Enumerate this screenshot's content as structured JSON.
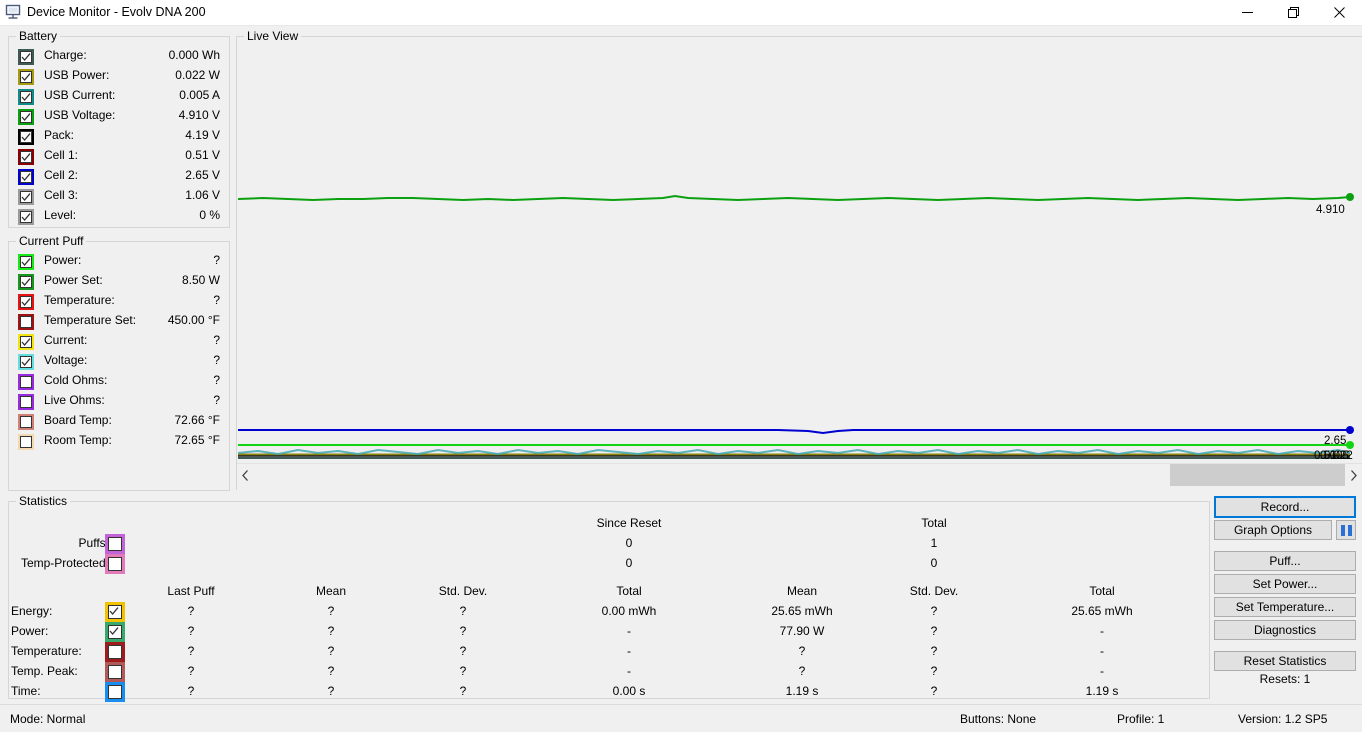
{
  "window": {
    "title": "Device Monitor - Evolv DNA 200",
    "icon": "monitor-icon",
    "controls": {
      "minimize": "minimize-icon",
      "maximize": "maximize-icon",
      "close": "close-icon"
    }
  },
  "battery": {
    "legend": "Battery",
    "items": [
      {
        "label": "Charge:",
        "value": "0.000 Wh",
        "checked": true,
        "color": "#3d5b54"
      },
      {
        "label": "USB Power:",
        "value": "0.022 W",
        "checked": true,
        "color": "#a89a10"
      },
      {
        "label": "USB Current:",
        "value": "0.005 A",
        "checked": true,
        "color": "#118a8a"
      },
      {
        "label": "USB Voltage:",
        "value": "4.910 V",
        "checked": true,
        "color": "#0aa010"
      },
      {
        "label": "Pack:",
        "value": "4.19 V",
        "checked": true,
        "color": "#000000"
      },
      {
        "label": "Cell 1:",
        "value": "0.51 V",
        "checked": true,
        "color": "#8a0000"
      },
      {
        "label": "Cell 2:",
        "value": "2.65 V",
        "checked": true,
        "color": "#0000d0"
      },
      {
        "label": "Cell 3:",
        "value": "1.06 V",
        "checked": true,
        "color": "#9a9a9a"
      },
      {
        "label": "Level:",
        "value": "0 %",
        "checked": true,
        "color": "#9a9a9a"
      }
    ]
  },
  "current_puff": {
    "legend": "Current Puff",
    "items": [
      {
        "label": "Power:",
        "value": "?",
        "checked": true,
        "color": "#18ea18"
      },
      {
        "label": "Power Set:",
        "value": "8.50 W",
        "checked": true,
        "color": "#18971f"
      },
      {
        "label": "Temperature:",
        "value": "?",
        "checked": true,
        "color": "#e81414"
      },
      {
        "label": "Temperature Set:",
        "value": "450.00 °F",
        "checked": false,
        "color": "#9e1414"
      },
      {
        "label": "Current:",
        "value": "?",
        "checked": true,
        "color": "#f2e410"
      },
      {
        "label": "Voltage:",
        "value": "?",
        "checked": true,
        "color": "#63dede"
      },
      {
        "label": "Cold Ohms:",
        "value": "?",
        "checked": false,
        "color": "#9a2ae0"
      },
      {
        "label": "Live Ohms:",
        "value": "?",
        "checked": false,
        "color": "#9a2ae0"
      },
      {
        "label": "Board Temp:",
        "value": "72.66 °F",
        "checked": false,
        "color": "#d08074"
      },
      {
        "label": "Room Temp:",
        "value": "72.65 °F",
        "checked": false,
        "color": "#f2d9b0"
      }
    ]
  },
  "live_view": {
    "legend": "Live View",
    "end_labels": [
      {
        "text": "4.910",
        "color": "#0aa010"
      },
      {
        "text": "2.65",
        "color": "#0000d0"
      },
      {
        "text": "0.51",
        "color": "#000000"
      },
      {
        "text": "0.005",
        "color": "#000000"
      },
      {
        "text": "0.022",
        "color": "#000000"
      }
    ],
    "scrollbar": {
      "left_arrow": "chevron-left-icon",
      "right_arrow": "chevron-right-icon"
    }
  },
  "statistics": {
    "legend": "Statistics",
    "group_headers": {
      "since_reset": "Since Reset",
      "total": "Total"
    },
    "puff_counts": [
      {
        "label": "Puffs:",
        "since_reset": "0",
        "total": "1",
        "color": "#c264d8",
        "checked": false
      },
      {
        "label": "Temp-Protected:",
        "since_reset": "0",
        "total": "0",
        "color": "#e07ab8",
        "checked": false
      }
    ],
    "columns": [
      "Last Puff",
      "Mean",
      "Std. Dev.",
      "Total",
      "Mean",
      "Std. Dev.",
      "Total"
    ],
    "rows": [
      {
        "label": "Energy:",
        "color": "#f2c200",
        "checked": true,
        "cells": [
          "?",
          "?",
          "?",
          "0.00 mWh",
          "25.65 mWh",
          "?",
          "25.65 mWh"
        ]
      },
      {
        "label": "Power:",
        "color": "#3aa86a",
        "checked": true,
        "cells": [
          "?",
          "?",
          "?",
          "-",
          "77.90 W",
          "?",
          "-"
        ]
      },
      {
        "label": "Temperature:",
        "color": "#9e1c1c",
        "checked": false,
        "cells": [
          "?",
          "?",
          "?",
          "-",
          "?",
          "?",
          "-"
        ]
      },
      {
        "label": "Temp. Peak:",
        "color": "#b05a5a",
        "checked": false,
        "cells": [
          "?",
          "?",
          "?",
          "-",
          "?",
          "?",
          "-"
        ]
      },
      {
        "label": "Time:",
        "color": "#1a8ef0",
        "checked": false,
        "cells": [
          "?",
          "?",
          "?",
          "0.00 s",
          "1.19 s",
          "?",
          "1.19 s"
        ]
      }
    ]
  },
  "actions": {
    "record": "Record...",
    "graph_options": "Graph Options",
    "pause": "pause-icon",
    "puff": "Puff...",
    "set_power": "Set Power...",
    "set_temperature": "Set Temperature...",
    "diagnostics": "Diagnostics",
    "reset_statistics": "Reset Statistics",
    "resets": "Resets: 1"
  },
  "statusbar": {
    "mode": "Mode: Normal",
    "buttons": "Buttons: None",
    "profile": "Profile: 1",
    "version": "Version: 1.2 SP5"
  }
}
